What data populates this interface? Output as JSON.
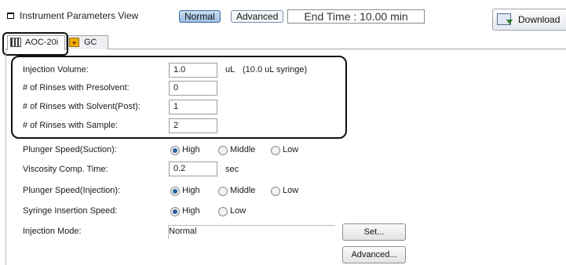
{
  "header": {
    "title": "Instrument Parameters View",
    "mode_normal": "Normal",
    "mode_advanced": "Advanced",
    "end_time": "End Time : 10.00 min",
    "download_label": "Download"
  },
  "tabs": [
    {
      "label": "AOC-20i",
      "icon": "autosampler-icon",
      "active": true
    },
    {
      "label": "GC",
      "icon": "gc-icon",
      "active": false
    }
  ],
  "form": {
    "injection_volume": {
      "label": "Injection Volume:",
      "value": "1.0",
      "unit": "uL",
      "note": "(10.0 uL syringe)"
    },
    "rinses_presolvent": {
      "label": "# of Rinses with Presolvent:",
      "value": "0"
    },
    "rinses_solvent_post": {
      "label": "# of Rinses with Solvent(Post):",
      "value": "1"
    },
    "rinses_sample": {
      "label": "# of Rinses with Sample:",
      "value": "2"
    },
    "plunger_suction": {
      "label": "Plunger Speed(Suction):",
      "options": [
        "High",
        "Middle",
        "Low"
      ],
      "selected": "High"
    },
    "viscosity_comp": {
      "label": "Viscosity Comp. Time:",
      "value": "0.2",
      "unit": "sec"
    },
    "plunger_injection": {
      "label": "Plunger Speed(Injection):",
      "options": [
        "High",
        "Middle",
        "Low"
      ],
      "selected": "High"
    },
    "syringe_insertion": {
      "label": "Syringe Insertion Speed:",
      "options": [
        "High",
        "Low"
      ],
      "selected": "High"
    },
    "injection_mode": {
      "label": "Injection Mode:",
      "value": "Normal"
    },
    "set_button": "Set...",
    "advanced_button": "Advanced..."
  },
  "colors": {
    "accent": "#2a5e9c",
    "active_mode": "#b5cde9"
  }
}
